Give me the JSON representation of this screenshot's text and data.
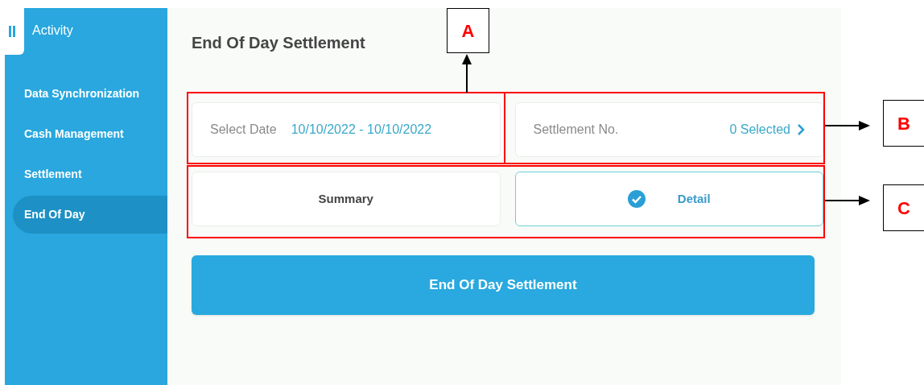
{
  "sidebar": {
    "header": "Activity",
    "items": [
      {
        "label": "Data Synchronization",
        "selected": false
      },
      {
        "label": "Cash Management",
        "selected": false
      },
      {
        "label": "Settlement",
        "selected": false
      },
      {
        "label": "End Of Day",
        "selected": true
      }
    ]
  },
  "page": {
    "title": "End Of Day Settlement",
    "date_field": {
      "label": "Select Date",
      "value": "10/10/2022 - 10/10/2022"
    },
    "settlement_field": {
      "label": "Settlement No.",
      "value": "0 Selected"
    },
    "view_options": [
      {
        "label": "Summary",
        "selected": false
      },
      {
        "label": "Detail",
        "selected": true
      }
    ],
    "action_button": "End Of Day Settlement"
  },
  "annotations": [
    {
      "label": "A"
    },
    {
      "label": "B"
    },
    {
      "label": "C"
    }
  ]
}
